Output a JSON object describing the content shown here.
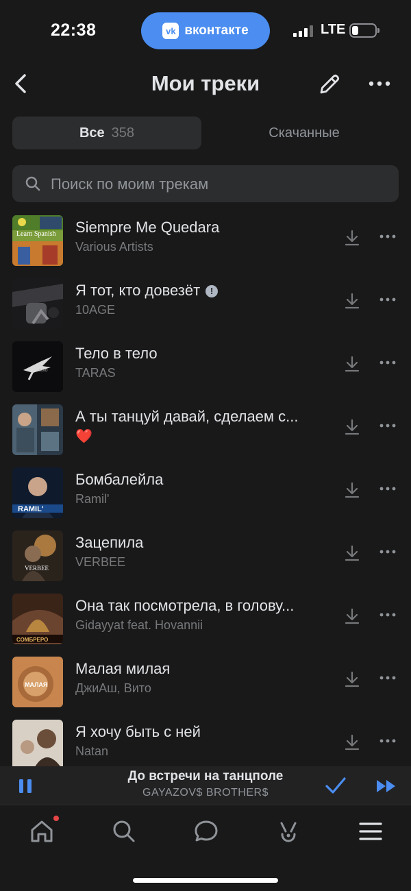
{
  "status_bar": {
    "time": "22:38",
    "app_pill": "вконтакте",
    "app_pill_logo": "vk",
    "network": "LTE",
    "battery_level": 0.2
  },
  "header": {
    "title": "Мои треки",
    "back_icon": "chevron-left-icon",
    "edit_icon": "pencil-icon",
    "more_icon": "more-horizontal-icon"
  },
  "tabs": {
    "all_label": "Все",
    "all_count": "358",
    "downloaded_label": "Скачанные"
  },
  "search": {
    "placeholder": "Поиск по моим трекам"
  },
  "tracks": [
    {
      "title": "Siempre Me Quedara",
      "artist": "Various Artists"
    },
    {
      "title": "Я тот, кто довезёт",
      "artist": "10AGE",
      "explicit": "!"
    },
    {
      "title": "Тело в тело",
      "artist": "TARAS"
    },
    {
      "title": "А ты танцуй давай, сделаем с...",
      "artist": "❤️"
    },
    {
      "title": "Бомбалейла",
      "artist": "Ramil'"
    },
    {
      "title": "Зацепила",
      "artist": "VERBEE"
    },
    {
      "title": "Она так посмотрела, в голову...",
      "artist": "Gidayyat feat. Hovannii"
    },
    {
      "title": "Малая милая",
      "artist": "ДжиАш, Вито"
    },
    {
      "title": "Я хочу быть с ней",
      "artist": "Natan"
    }
  ],
  "cover_texts": {
    "c1": "Learn Spanish",
    "c5": "RAMIL'",
    "c6": "VERBEE",
    "c7": "СОМБРЕРО",
    "c8": "МАЛАЯ"
  },
  "player": {
    "title": "До встречи на танцполе",
    "artist": "GAYAZOV$ BROTHER$"
  },
  "nav": {
    "items": [
      "home-icon",
      "search-icon",
      "messages-icon",
      "clips-icon",
      "menu-icon"
    ]
  },
  "colors": {
    "accent": "#4b8df0",
    "background": "#19191a",
    "surface": "#2c2d2e",
    "notification": "#e64646"
  }
}
